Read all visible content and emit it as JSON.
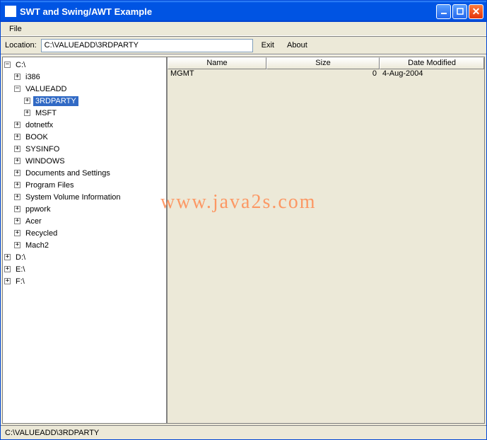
{
  "window": {
    "title": "SWT and Swing/AWT Example"
  },
  "menubar": {
    "file": "File"
  },
  "toolbar": {
    "location_label": "Location:",
    "location_value": "C:\\VALUEADD\\3RDPARTY",
    "exit": "Exit",
    "about": "About"
  },
  "tree": {
    "root_c": "C:\\",
    "i386": "i386",
    "valueadd": "VALUEADD",
    "thirdparty": "3RDPARTY",
    "msft": "MSFT",
    "dotnetfx": "dotnetfx",
    "book": "BOOK",
    "sysinfo": "SYSINFO",
    "windows": "WINDOWS",
    "docs": "Documents and Settings",
    "progfiles": "Program Files",
    "sysvol": "System Volume Information",
    "ppwork": "ppwork",
    "acer": "Acer",
    "recycled": "Recycled",
    "mach2": "Mach2",
    "root_d": "D:\\",
    "root_e": "E:\\",
    "root_f": "F:\\"
  },
  "table": {
    "columns": {
      "name": "Name",
      "size": "Size",
      "date": "Date Modified"
    },
    "rows": [
      {
        "name": "MGMT",
        "size": "0",
        "date": "4-Aug-2004"
      }
    ]
  },
  "watermark": "www.java2s.com",
  "statusbar": {
    "path": "C:\\VALUEADD\\3RDPARTY"
  }
}
